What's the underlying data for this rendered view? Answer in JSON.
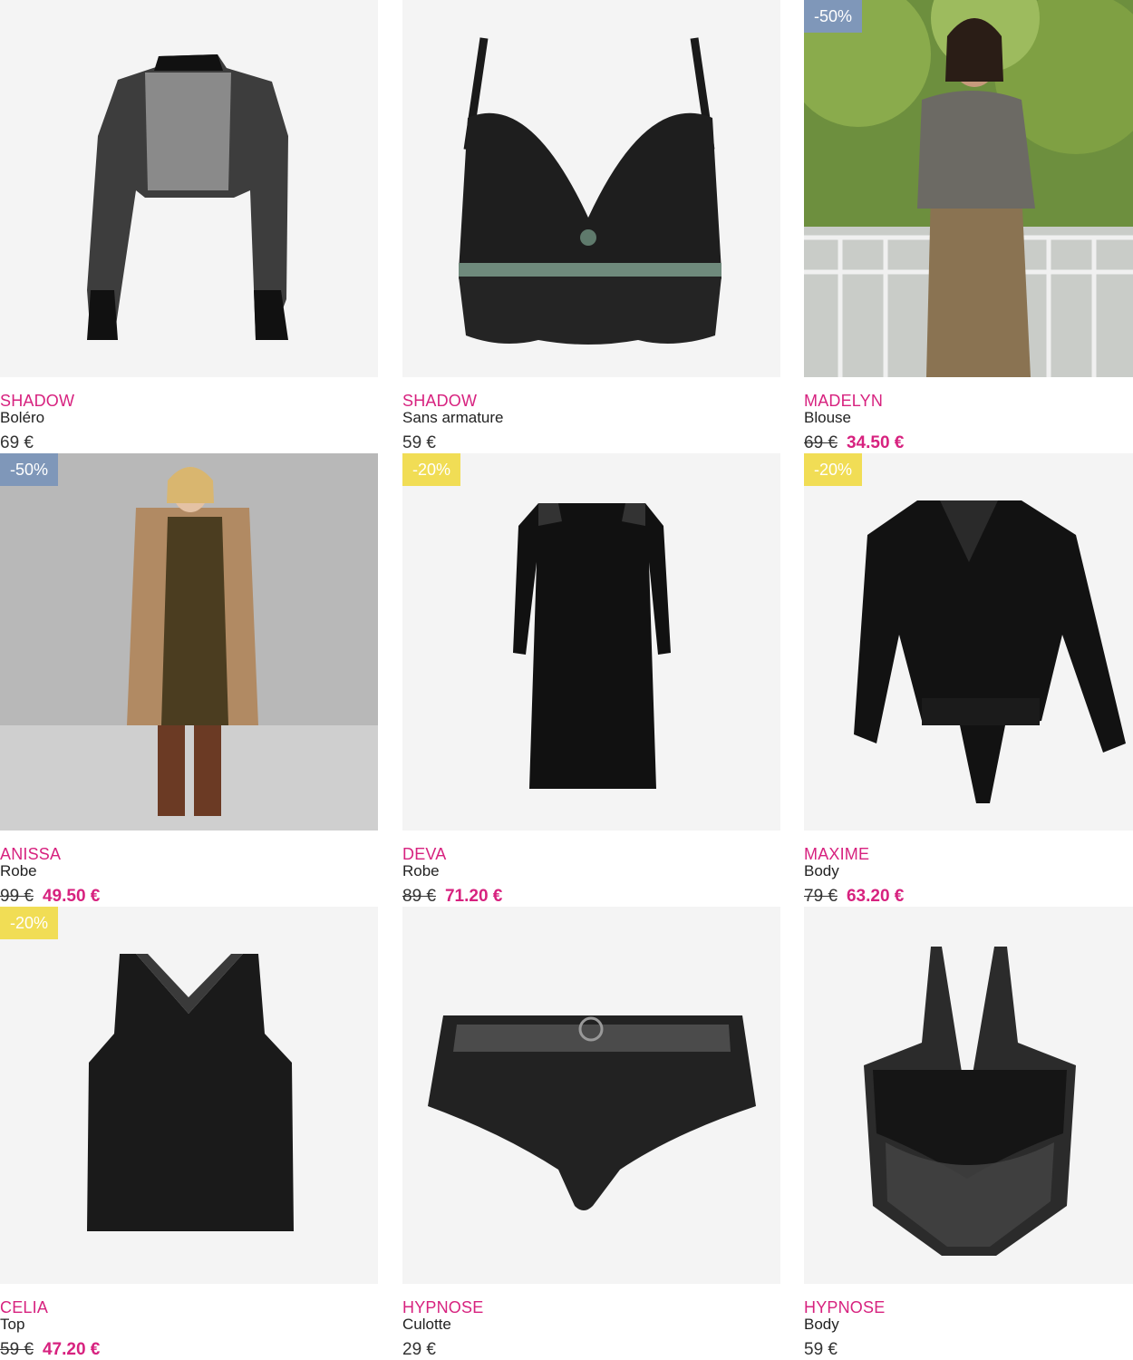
{
  "colors": {
    "brand_pink": "#d7227f",
    "badge_blue": "#7f97b9",
    "badge_yellow": "#f1dd55",
    "image_bg": "#f4f4f4"
  },
  "products": [
    {
      "brand": "SHADOW",
      "name": "Boléro",
      "price": "69 €",
      "image": "lace-bolero-photo"
    },
    {
      "brand": "SHADOW",
      "name": "Sans armature",
      "price": "59 €",
      "image": "lace-bralette-photo"
    },
    {
      "brand": "MADELYN",
      "name": "Blouse",
      "badge": "-50%",
      "old_price": "69 €",
      "new_price": "34.50 €",
      "image": "woman-blouse-outdoor-photo"
    },
    {
      "brand": "ANISSA",
      "name": "Robe",
      "badge": "-50%",
      "old_price": "99 €",
      "new_price": "49.50 €",
      "image": "woman-robe-cardigan-photo"
    },
    {
      "brand": "DEVA",
      "name": "Robe",
      "badge": "-20%",
      "old_price": "89 €",
      "new_price": "71.20 €",
      "image": "black-lace-dress-photo"
    },
    {
      "brand": "MAXIME",
      "name": "Body",
      "badge": "-20%",
      "old_price": "79 €",
      "new_price": "63.20 €",
      "image": "black-blouse-body-photo"
    },
    {
      "brand": "CELIA",
      "name": "Top",
      "badge": "-20%",
      "old_price": "59 €",
      "new_price": "47.20 €",
      "image": "black-lace-top-photo"
    },
    {
      "brand": "HYPNOSE",
      "name": "Culotte",
      "price": "29 €",
      "image": "lace-culotte-photo"
    },
    {
      "brand": "HYPNOSE",
      "name": "Body",
      "price": "59 €",
      "image": "lace-bodysuit-photo"
    }
  ]
}
